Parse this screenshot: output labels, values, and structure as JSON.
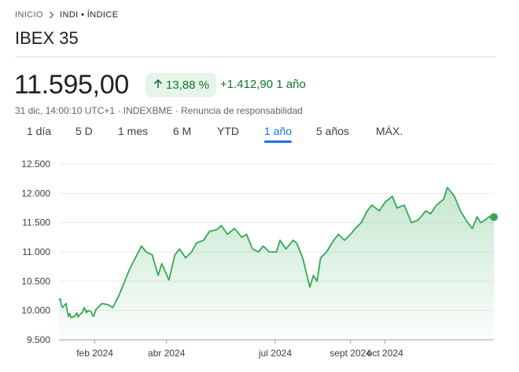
{
  "breadcrumb": {
    "home": "INICIO",
    "current": "INDI • ÍNDICE"
  },
  "title": "IBEX 35",
  "quote": {
    "price": "11.595,00",
    "change_pct": "13,88 %",
    "change_abs": "+1.412,90",
    "change_period": "1 año",
    "timestamp": "31 dic, 14:00:10 UTC+1",
    "exchange": "INDEXBME",
    "disclaimer": "Renuncia de responsabilidad"
  },
  "icons": {
    "breadcrumb_sep": "chevron-right-icon",
    "change_arrow": "arrow-up-icon"
  },
  "colors": {
    "positive": "#137333",
    "line": "#34a853",
    "accent": "#1a73e8"
  },
  "tabs": [
    {
      "label": "1 día",
      "active": false
    },
    {
      "label": "5 D",
      "active": false
    },
    {
      "label": "1 mes",
      "active": false
    },
    {
      "label": "6 M",
      "active": false
    },
    {
      "label": "YTD",
      "active": false
    },
    {
      "label": "1 año",
      "active": true
    },
    {
      "label": "5 años",
      "active": false
    },
    {
      "label": "MÁX.",
      "active": false
    }
  ],
  "chart_data": {
    "type": "area",
    "title": "",
    "xlabel": "",
    "ylabel": "",
    "ylim": [
      9500,
      12500
    ],
    "y_ticks": [
      12500,
      12000,
      11500,
      11000,
      10500,
      10000,
      9500
    ],
    "y_tick_labels": [
      "12.500",
      "12.000",
      "11.500",
      "11.000",
      "10.500",
      "10.000",
      "9.500"
    ],
    "xlim": [
      "2024-01-02",
      "2024-12-31"
    ],
    "x_ticks": [
      "2024-02-01",
      "2024-04-01",
      "2024-07-01",
      "2024-09-02",
      "2024-10-01"
    ],
    "x_tick_labels": [
      "feb 2024",
      "abr 2024",
      "jul 2024",
      "sept 2024",
      "oct 2024"
    ],
    "grid": true,
    "legend": "none",
    "series": [
      {
        "x": [
          "2024-01-02",
          "2024-01-03",
          "2024-01-04",
          "2024-01-05",
          "2024-01-08",
          "2024-01-09",
          "2024-01-10",
          "2024-01-11",
          "2024-01-12",
          "2024-01-15",
          "2024-01-16",
          "2024-01-17",
          "2024-01-18",
          "2024-01-19",
          "2024-01-22",
          "2024-01-23",
          "2024-01-24",
          "2024-01-25",
          "2024-01-26",
          "2024-01-29",
          "2024-01-30",
          "2024-01-31",
          "2024-02-02",
          "2024-02-07",
          "2024-02-12",
          "2024-02-16",
          "2024-02-21",
          "2024-02-26",
          "2024-03-01",
          "2024-03-06",
          "2024-03-11",
          "2024-03-15",
          "2024-03-20",
          "2024-03-25",
          "2024-03-28",
          "2024-04-03",
          "2024-04-08",
          "2024-04-12",
          "2024-04-17",
          "2024-04-22",
          "2024-04-26",
          "2024-05-02",
          "2024-05-07",
          "2024-05-13",
          "2024-05-17",
          "2024-05-22",
          "2024-05-28",
          "2024-06-03",
          "2024-06-07",
          "2024-06-12",
          "2024-06-17",
          "2024-06-21",
          "2024-06-26",
          "2024-07-02",
          "2024-07-05",
          "2024-07-10",
          "2024-07-16",
          "2024-07-19",
          "2024-07-24",
          "2024-07-30",
          "2024-08-02",
          "2024-08-05",
          "2024-08-08",
          "2024-08-13",
          "2024-08-19",
          "2024-08-23",
          "2024-08-28",
          "2024-09-02",
          "2024-09-06",
          "2024-09-11",
          "2024-09-16",
          "2024-09-20",
          "2024-09-26",
          "2024-10-01",
          "2024-10-07",
          "2024-10-11",
          "2024-10-17",
          "2024-10-23",
          "2024-10-29",
          "2024-11-04",
          "2024-11-08",
          "2024-11-13",
          "2024-11-19",
          "2024-11-22",
          "2024-11-28",
          "2024-12-03",
          "2024-12-09",
          "2024-12-13",
          "2024-12-17",
          "2024-12-20",
          "2024-12-24",
          "2024-12-27",
          "2024-12-31"
        ],
        "values": [
          10180,
          10200,
          10100,
          10050,
          10120,
          9980,
          9900,
          9950,
          9880,
          9900,
          9930,
          9960,
          9890,
          9920,
          9980,
          10050,
          10020,
          9960,
          10000,
          9980,
          9920,
          9900,
          10020,
          10120,
          10100,
          10050,
          10250,
          10500,
          10700,
          10900,
          11100,
          11000,
          10950,
          10600,
          10800,
          10520,
          10950,
          11050,
          10900,
          11000,
          11150,
          11200,
          11350,
          11380,
          11450,
          11300,
          11400,
          11250,
          11300,
          11050,
          11000,
          11100,
          11000,
          11000,
          11200,
          11050,
          11200,
          11150,
          10900,
          10400,
          10600,
          10500,
          10900,
          11000,
          11200,
          11300,
          11200,
          11300,
          11400,
          11500,
          11700,
          11800,
          11700,
          11850,
          11950,
          11750,
          11800,
          11500,
          11550,
          11700,
          11650,
          11800,
          11900,
          12100,
          11950,
          11700,
          11500,
          11400,
          11600,
          11500,
          11550,
          11600,
          11595
        ]
      }
    ]
  }
}
